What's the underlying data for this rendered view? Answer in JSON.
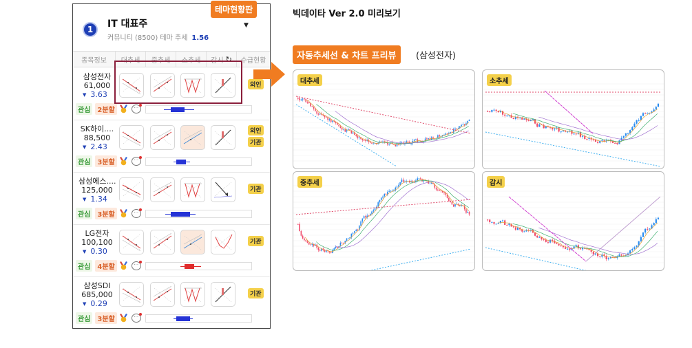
{
  "panel": {
    "number": "1",
    "title": "IT 대표주",
    "subtitle": "커뮤니티 (8500)  테마 추세",
    "trend_value": "1.56",
    "theme_tag": "테마현황판"
  },
  "columns": [
    "종목정보",
    "대추세",
    "중추세",
    "소추세",
    "감시",
    "수급현황"
  ],
  "stocks": [
    {
      "name": "삼성전자",
      "price": "61,000",
      "change": "3.63",
      "share_label": "2분할",
      "tags": [
        "외인"
      ],
      "range_color": "blue"
    },
    {
      "name": "SK하이....",
      "price": "88,500",
      "change": "2.43",
      "share_label": "3분할",
      "tags": [
        "외인",
        "기관"
      ],
      "range_color": "blue"
    },
    {
      "name": "삼성에스....",
      "price": "125,000",
      "change": "1.34",
      "share_label": "3분할",
      "tags": [
        "기관"
      ],
      "range_color": "blue"
    },
    {
      "name": "LG전자",
      "price": "100,100",
      "change": "0.30",
      "share_label": "4분할",
      "tags": [
        "기관"
      ],
      "range_color": "red"
    },
    {
      "name": "삼성SDI",
      "price": "685,000",
      "change": "0.29",
      "share_label": "3분할",
      "tags": [
        "기관"
      ],
      "range_color": "blue"
    }
  ],
  "interest_label": "관심",
  "chat_icon_glyph": "···",
  "preview": {
    "title": "빅데이타 Ver 2.0 미리보기",
    "tag": "자동추세선 & 차트 프리뷰",
    "paren": "(삼성전자)",
    "charts": [
      {
        "label": "대추세"
      },
      {
        "label": "소추세"
      },
      {
        "label": "중추세"
      },
      {
        "label": "감시"
      }
    ]
  },
  "colors": {
    "accent": "#f07c21",
    "down": "#1e3fb5",
    "highlight": "#8a1e3b",
    "label": "#f4d04a"
  },
  "icons": [
    "refresh-icon",
    "caret-down-icon",
    "medal-icon",
    "chat-icon",
    "arrow-right-icon"
  ]
}
